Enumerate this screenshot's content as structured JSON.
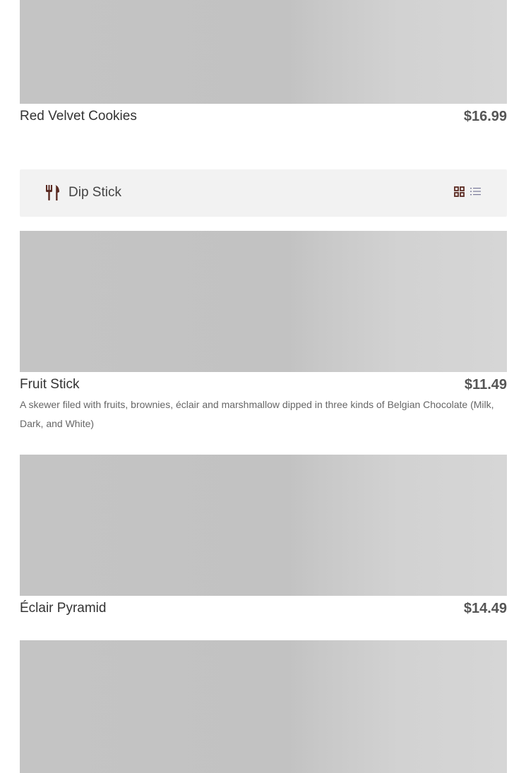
{
  "category": {
    "title": "Dip Stick",
    "icon": "utensils-icon",
    "views": [
      "grid-view-icon",
      "list-view-icon"
    ],
    "accent_color": "#5a2a22"
  },
  "items": [
    {
      "name": "Red Velvet Cookies",
      "price": "$16.99",
      "description": ""
    },
    {
      "name": "Fruit Stick",
      "price": "$11.49",
      "description": "A skewer filed with fruits, brownies, éclair and marshmallow dipped in three kinds of Belgian Chocolate (Milk, Dark, and White)"
    },
    {
      "name": "Éclair Pyramid",
      "price": "$14.49",
      "description": ""
    }
  ]
}
